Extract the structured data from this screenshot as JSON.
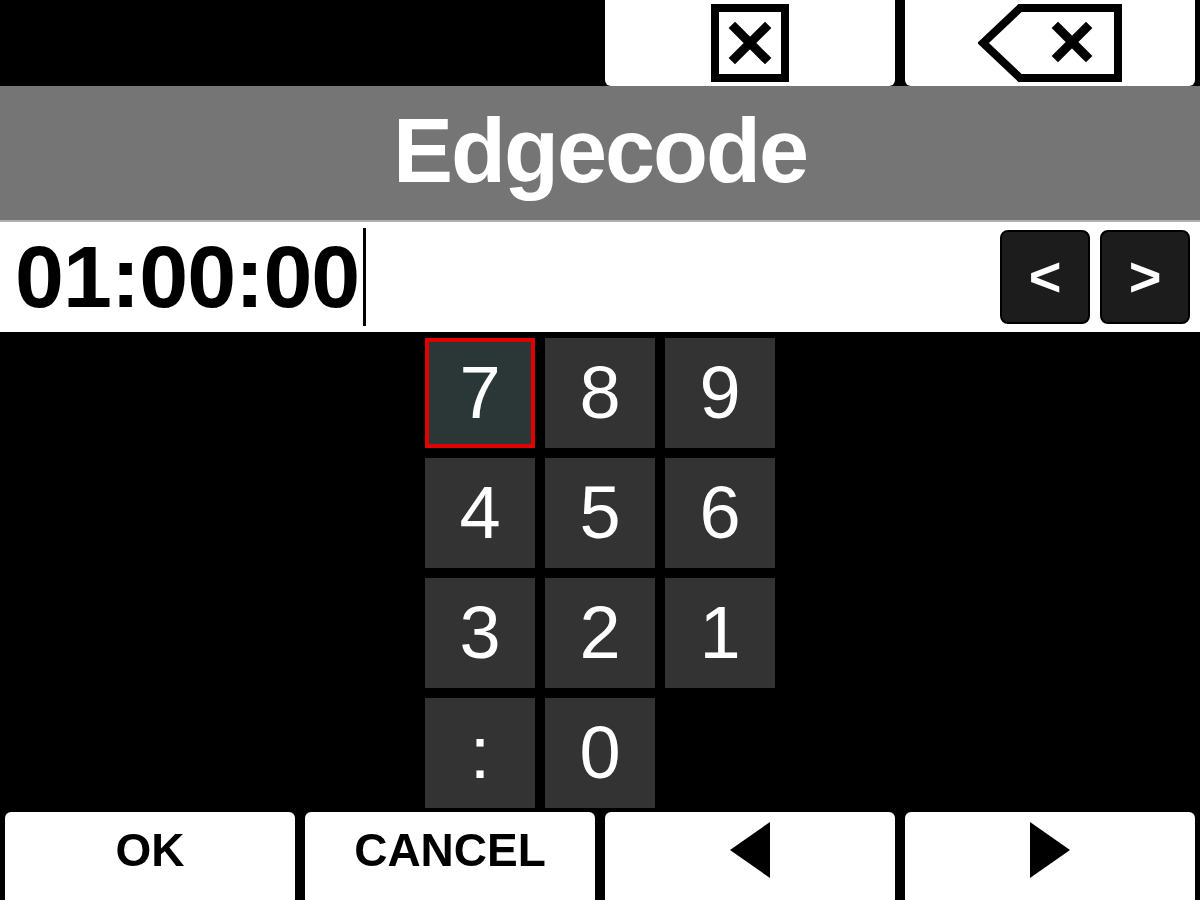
{
  "title": "Edgecode",
  "field": {
    "value": "01:00:00"
  },
  "cursor_buttons": [
    "<",
    ">"
  ],
  "keypad": {
    "rows": [
      [
        {
          "label": "7",
          "selected": true
        },
        {
          "label": "8",
          "selected": false
        },
        {
          "label": "9",
          "selected": false
        }
      ],
      [
        {
          "label": "4",
          "selected": false
        },
        {
          "label": "5",
          "selected": false
        },
        {
          "label": "6",
          "selected": false
        }
      ],
      [
        {
          "label": "3",
          "selected": false
        },
        {
          "label": "2",
          "selected": false
        },
        {
          "label": "1",
          "selected": false
        }
      ],
      [
        {
          "label": ":",
          "selected": false
        },
        {
          "label": "0",
          "selected": false
        }
      ]
    ]
  },
  "softkeys": [
    "OK",
    "CANCEL"
  ]
}
